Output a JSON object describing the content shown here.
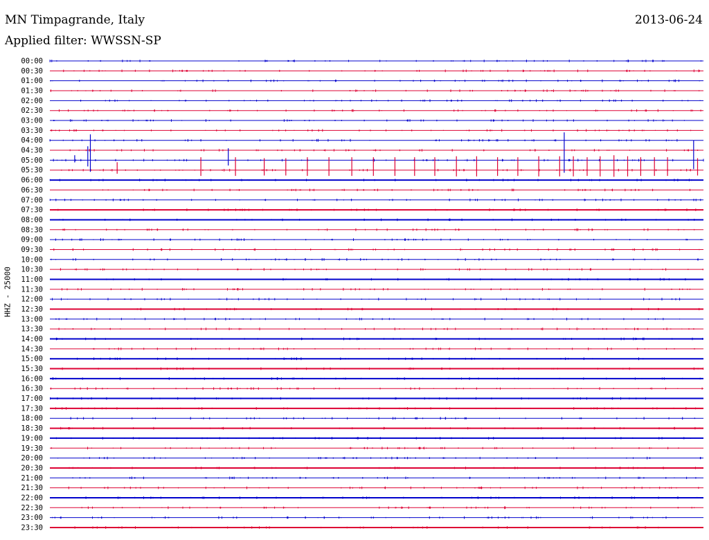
{
  "header": {
    "title": "MN Timpagrande, Italy",
    "date": "2013-06-24",
    "filter": "Applied filter: WWSSN-SP"
  },
  "chart_data": {
    "type": "line",
    "title": "MN Timpagrande, Italy",
    "ylabel": "HHZ - 25000",
    "colors": {
      "even_hour": "#0000cc",
      "half_hour": "#dd0033"
    },
    "rows": [
      {
        "label": "00:00",
        "thick": false
      },
      {
        "label": "00:30",
        "thick": false
      },
      {
        "label": "01:00",
        "thick": false
      },
      {
        "label": "01:30",
        "thick": false
      },
      {
        "label": "02:00",
        "thick": false
      },
      {
        "label": "02:30",
        "thick": false
      },
      {
        "label": "03:00",
        "thick": false
      },
      {
        "label": "03:30",
        "thick": false
      },
      {
        "label": "04:00",
        "thick": false
      },
      {
        "label": "04:30",
        "thick": false
      },
      {
        "label": "05:00",
        "thick": false
      },
      {
        "label": "05:30",
        "thick": false
      },
      {
        "label": "06:00",
        "thick": true
      },
      {
        "label": "06:30",
        "thick": false
      },
      {
        "label": "07:00",
        "thick": false
      },
      {
        "label": "07:30",
        "thick": true
      },
      {
        "label": "08:00",
        "thick": true
      },
      {
        "label": "08:30",
        "thick": false
      },
      {
        "label": "09:00",
        "thick": false
      },
      {
        "label": "09:30",
        "thick": false
      },
      {
        "label": "10:00",
        "thick": false
      },
      {
        "label": "10:30",
        "thick": false
      },
      {
        "label": "11:00",
        "thick": true
      },
      {
        "label": "11:30",
        "thick": false
      },
      {
        "label": "12:00",
        "thick": false
      },
      {
        "label": "12:30",
        "thick": true
      },
      {
        "label": "13:00",
        "thick": false
      },
      {
        "label": "13:30",
        "thick": false
      },
      {
        "label": "14:00",
        "thick": true
      },
      {
        "label": "14:30",
        "thick": false
      },
      {
        "label": "15:00",
        "thick": true
      },
      {
        "label": "15:30",
        "thick": true
      },
      {
        "label": "16:00",
        "thick": true
      },
      {
        "label": "16:30",
        "thick": false
      },
      {
        "label": "17:00",
        "thick": true
      },
      {
        "label": "17:30",
        "thick": true
      },
      {
        "label": "18:00",
        "thick": false
      },
      {
        "label": "18:30",
        "thick": true
      },
      {
        "label": "19:00",
        "thick": true
      },
      {
        "label": "19:30",
        "thick": false
      },
      {
        "label": "20:00",
        "thick": false
      },
      {
        "label": "20:30",
        "thick": true
      },
      {
        "label": "21:00",
        "thick": false
      },
      {
        "label": "21:30",
        "thick": false
      },
      {
        "label": "22:00",
        "thick": true
      },
      {
        "label": "22:30",
        "thick": false
      },
      {
        "label": "23:00",
        "thick": false
      },
      {
        "label": "23:30",
        "thick": true
      }
    ],
    "spikes": [
      {
        "row": 10,
        "x": 0.038,
        "amp": 0.5
      },
      {
        "row": 10,
        "x": 0.058,
        "amp": 1.4
      },
      {
        "row": 10,
        "x": 0.062,
        "amp": 2.6
      },
      {
        "row": 11,
        "x": 0.103,
        "amp": 0.8
      },
      {
        "row": 11,
        "x": 0.231,
        "amp": 1.3
      },
      {
        "row": 10,
        "x": 0.273,
        "amp": 1.2
      },
      {
        "row": 11,
        "x": 0.284,
        "amp": 1.3
      },
      {
        "row": 11,
        "x": 0.328,
        "amp": 1.2
      },
      {
        "row": 11,
        "x": 0.361,
        "amp": 1.2
      },
      {
        "row": 11,
        "x": 0.394,
        "amp": 1.3
      },
      {
        "row": 11,
        "x": 0.427,
        "amp": 1.3
      },
      {
        "row": 11,
        "x": 0.462,
        "amp": 1.3
      },
      {
        "row": 11,
        "x": 0.495,
        "amp": 1.3
      },
      {
        "row": 11,
        "x": 0.528,
        "amp": 1.3
      },
      {
        "row": 11,
        "x": 0.558,
        "amp": 1.3
      },
      {
        "row": 11,
        "x": 0.589,
        "amp": 1.3
      },
      {
        "row": 11,
        "x": 0.622,
        "amp": 1.4
      },
      {
        "row": 11,
        "x": 0.653,
        "amp": 1.4
      },
      {
        "row": 11,
        "x": 0.685,
        "amp": 1.3
      },
      {
        "row": 11,
        "x": 0.716,
        "amp": 1.3
      },
      {
        "row": 11,
        "x": 0.748,
        "amp": 1.4
      },
      {
        "row": 10,
        "x": 0.787,
        "amp": 2.8
      },
      {
        "row": 11,
        "x": 0.78,
        "amp": 1.4
      },
      {
        "row": 11,
        "x": 0.801,
        "amp": 1.4
      },
      {
        "row": 11,
        "x": 0.822,
        "amp": 1.3
      },
      {
        "row": 11,
        "x": 0.842,
        "amp": 1.4
      },
      {
        "row": 11,
        "x": 0.863,
        "amp": 1.5
      },
      {
        "row": 11,
        "x": 0.884,
        "amp": 1.4
      },
      {
        "row": 11,
        "x": 0.904,
        "amp": 1.3
      },
      {
        "row": 11,
        "x": 0.925,
        "amp": 1.3
      },
      {
        "row": 11,
        "x": 0.945,
        "amp": 1.3
      },
      {
        "row": 10,
        "x": 0.985,
        "amp": 2.0
      },
      {
        "row": 11,
        "x": 0.991,
        "amp": 1.2
      }
    ]
  }
}
